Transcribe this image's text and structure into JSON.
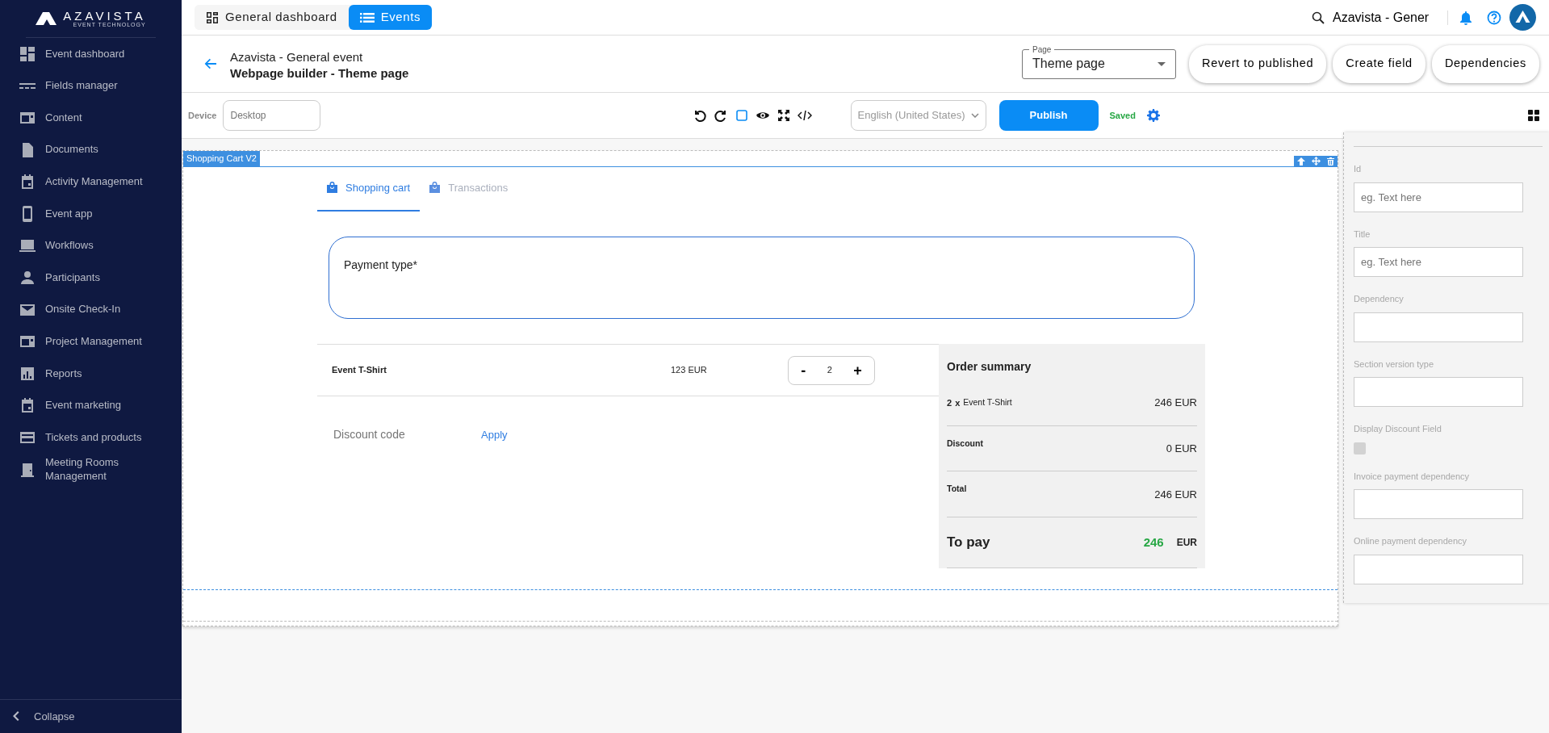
{
  "brand": {
    "name": "AZAVISTA",
    "tagline": "EVENT TECHNOLOGY"
  },
  "sidebar": {
    "items": [
      {
        "label": "Event dashboard"
      },
      {
        "label": "Fields manager"
      },
      {
        "label": "Content"
      },
      {
        "label": "Documents"
      },
      {
        "label": "Activity Management"
      },
      {
        "label": "Event app"
      },
      {
        "label": "Workflows"
      },
      {
        "label": "Participants"
      },
      {
        "label": "Onsite Check-In"
      },
      {
        "label": "Project Management"
      },
      {
        "label": "Reports"
      },
      {
        "label": "Event marketing"
      },
      {
        "label": "Tickets and products"
      },
      {
        "label": "Meeting Rooms Management"
      }
    ],
    "collapse": "Collapse"
  },
  "top_tabs": [
    {
      "label": "General dashboard",
      "selected": false
    },
    {
      "label": "Events",
      "selected": true
    }
  ],
  "search": {
    "value": "Azavista - Gener"
  },
  "header": {
    "event": "Azavista - General event",
    "page_title": "Webpage builder - Theme page",
    "page_select": {
      "label": "Page",
      "value": "Theme page"
    },
    "buttons": [
      "Revert to published",
      "Create field",
      "Dependencies"
    ]
  },
  "toolbar": {
    "device": {
      "label": "Device",
      "placeholder": "Desktop"
    },
    "language": "English (United States)",
    "publish": "Publish",
    "status": "Saved"
  },
  "component": {
    "label": "Shopping Cart V2",
    "tabs": [
      {
        "label": "Shopping cart",
        "selected": true
      },
      {
        "label": "Transactions",
        "selected": false
      }
    ],
    "payment_type": "Payment type*",
    "items": [
      {
        "name": "Event T-Shirt",
        "price": "123 EUR",
        "quantity": "2",
        "decrease": "-",
        "increase": "+"
      }
    ],
    "discount": {
      "placeholder": "Discount code",
      "apply": "Apply"
    },
    "summary": {
      "title": "Order summary",
      "rows": [
        {
          "quantity": "2",
          "times": "x",
          "label": "Event T-Shirt",
          "amount": "246 EUR"
        },
        {
          "label": "Discount",
          "amount": "0 EUR"
        },
        {
          "label": "Total",
          "amount": "246 EUR"
        }
      ],
      "to_pay": {
        "label": "To pay",
        "amount": "246",
        "currency": "EUR"
      }
    }
  },
  "settings": {
    "fields": [
      {
        "kind": "text",
        "label": "Id",
        "placeholder": "eg. Text here"
      },
      {
        "kind": "text",
        "label": "Title",
        "placeholder": "eg. Text here"
      },
      {
        "kind": "text",
        "label": "Dependency"
      },
      {
        "kind": "text",
        "label": "Section version type"
      },
      {
        "kind": "checkbox",
        "label": "Display Discount Field",
        "checked": false
      },
      {
        "kind": "text",
        "label": "Invoice payment dependency"
      },
      {
        "kind": "text",
        "label": "Online payment dependency"
      }
    ]
  }
}
